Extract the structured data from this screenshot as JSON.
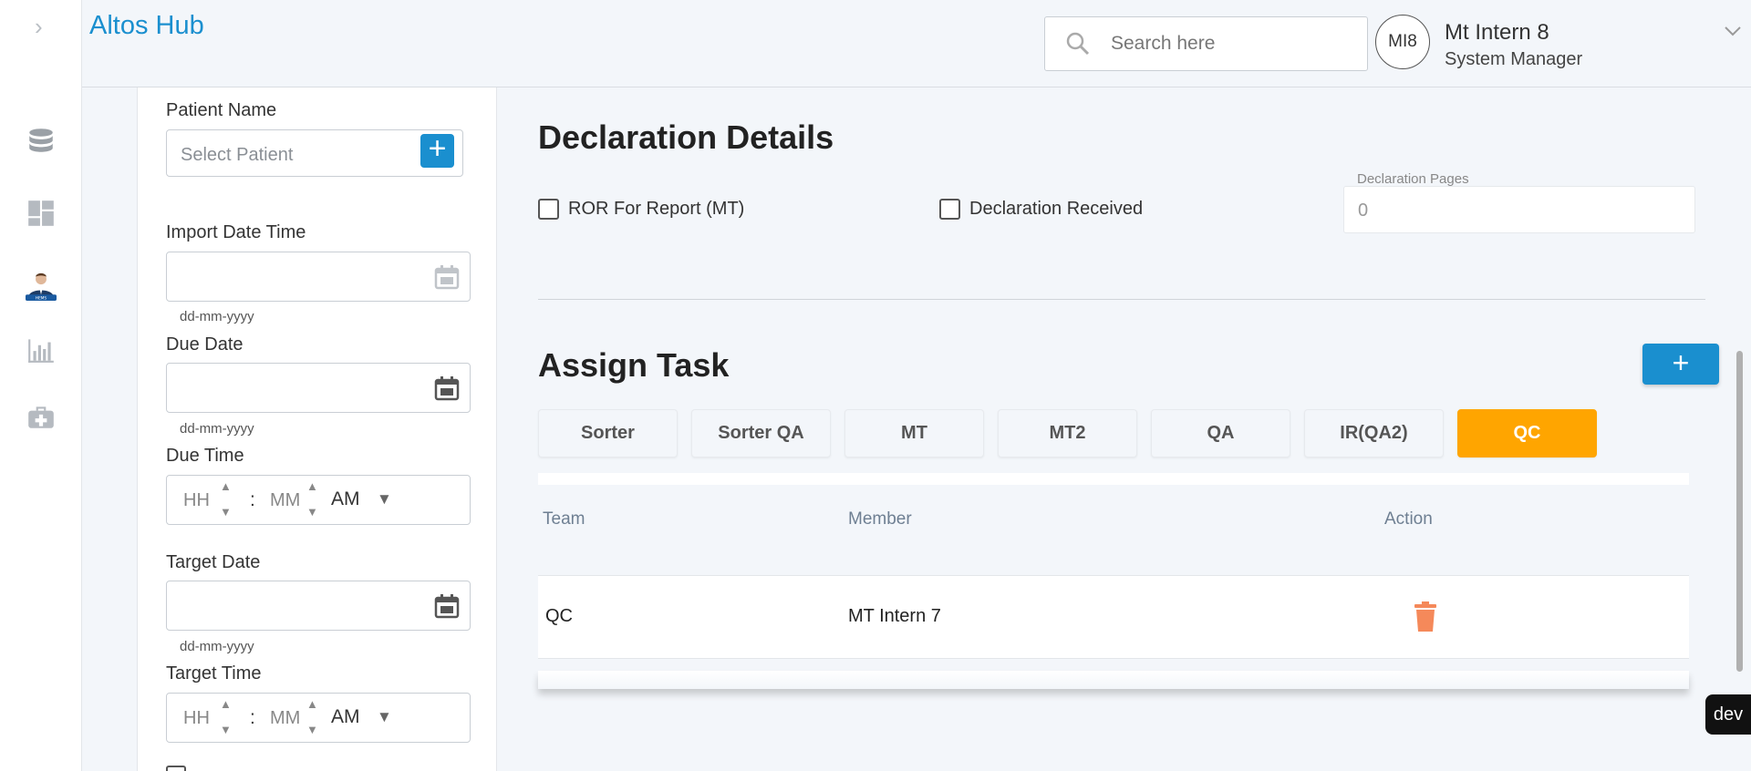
{
  "brand": "Altos Hub",
  "header": {
    "search_placeholder": "Search here",
    "avatar_initials": "MI8",
    "user_name": "Mt Intern 8",
    "user_role": "System Manager"
  },
  "rail": {
    "items": [
      {
        "icon": "database-icon"
      },
      {
        "icon": "dashboard-icon"
      },
      {
        "icon": "hems-avatar-icon"
      },
      {
        "icon": "bar-chart-icon"
      },
      {
        "icon": "medical-kit-icon"
      }
    ]
  },
  "form": {
    "patient_name_label": "Patient Name",
    "patient_placeholder": "Select Patient",
    "import_label": "Import Date Time",
    "date_hint": "dd-mm-yyyy",
    "due_date_label": "Due Date",
    "due_time_label": "Due Time",
    "target_date_label": "Target Date",
    "target_time_label": "Target Time",
    "time_hh": "HH",
    "time_mm": "MM",
    "time_sep": ":",
    "time_ampm": "AM"
  },
  "declaration": {
    "title": "Declaration Details",
    "ror_label": "ROR For Report (MT)",
    "received_label": "Declaration Received",
    "pages_label": "Declaration Pages",
    "pages_value": "0"
  },
  "assign": {
    "title": "Assign Task",
    "add_label": "+",
    "tabs": [
      "Sorter",
      "Sorter QA",
      "MT",
      "MT2",
      "QA",
      "IR(QA2)",
      "QC"
    ],
    "active_tab": "QC",
    "columns": [
      "Team",
      "Member",
      "Action"
    ],
    "rows": [
      {
        "team": "QC",
        "member": "MT Intern 7"
      }
    ]
  },
  "dev_badge": "dev",
  "colors": {
    "accent": "#1a8fcf",
    "active_tab": "#ffa500",
    "delete": "#f5895a"
  }
}
